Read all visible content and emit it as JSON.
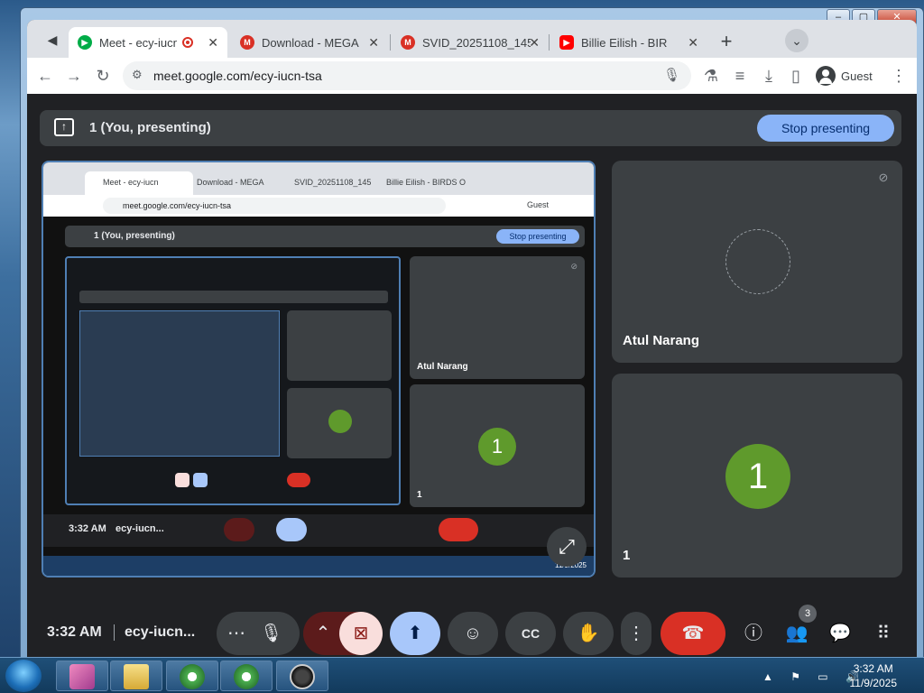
{
  "browser": {
    "tabs": [
      {
        "label": "Meet - ecy-iucn",
        "active": true,
        "favicon": "meet-icon"
      },
      {
        "label": "Download - MEGA",
        "active": false,
        "favicon": "mega-icon"
      },
      {
        "label": "SVID_20251108_145",
        "active": false,
        "favicon": "mega-icon"
      },
      {
        "label": "Billie Eilish - BIRDS O",
        "active": false,
        "favicon": "youtube-icon"
      }
    ],
    "url": "meet.google.com/ecy-iucn-tsa",
    "profile_label": "Guest"
  },
  "meet": {
    "presenting_label": "1 (You, presenting)",
    "stop_presenting": "Stop presenting",
    "participants": [
      {
        "name": "Atul Narang"
      },
      {
        "name": "1",
        "initial": "1"
      }
    ],
    "time": "3:32 AM",
    "meeting_code": "ecy-iucn...",
    "people_count": "3",
    "nested": {
      "presenting_label": "1 (You, presenting)",
      "stop_presenting": "Stop presenting",
      "time": "3:32 AM",
      "code": "ecy-iucn...",
      "participant_a": "Atul Narang",
      "participant_b": "1",
      "url": "meet.google.com/ecy-iucn-tsa",
      "tab1": "Meet - ecy-iucn",
      "tab2": "Download - MEGA",
      "tab3": "SVID_20251108_145",
      "tab4": "Billie Eilish - BIRDS O",
      "guest": "Guest",
      "date": "11/9/2025"
    }
  },
  "taskbar": {
    "time": "3:32 AM",
    "date": "11/9/2025"
  },
  "colors": {
    "accent_blue": "#8ab4f8",
    "end_call_red": "#d93025",
    "avatar_green": "#5f9a2c",
    "tile_gray": "#3c4043"
  }
}
